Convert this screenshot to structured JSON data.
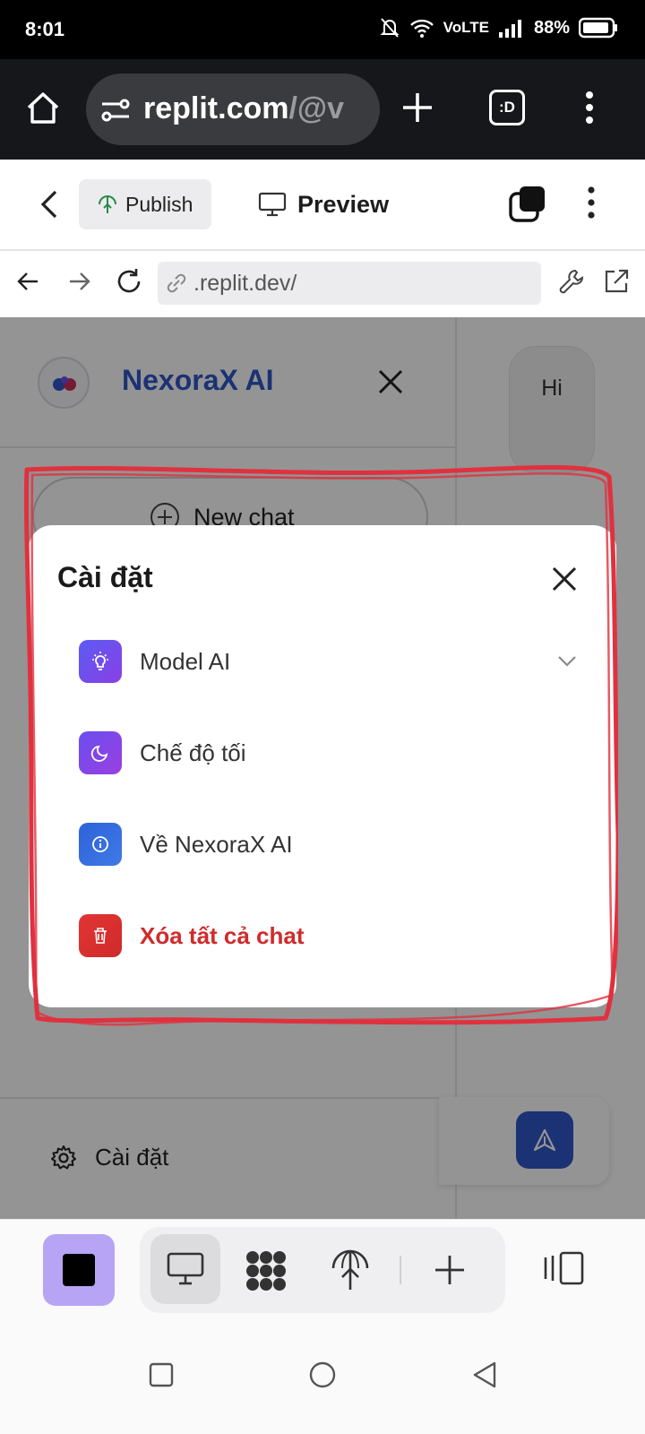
{
  "status_bar": {
    "time": "8:01",
    "network": "VoLTE",
    "battery": "88%"
  },
  "chrome": {
    "url_main": "replit.com",
    "url_tail": "/@v",
    "tab_button_label": ":D"
  },
  "replit": {
    "publish_label": "Publish",
    "preview_label": "Preview"
  },
  "browser": {
    "address": ".replit.dev/"
  },
  "sidebar": {
    "brand": "NexoraX AI",
    "new_chat_label": "New chat",
    "settings_label": "Cài đặt"
  },
  "chat": {
    "message": "Hi"
  },
  "modal": {
    "title": "Cài đặt",
    "items": [
      {
        "label": "Model AI",
        "icon": "lightbulb-icon",
        "color": "#6b4ef0"
      },
      {
        "label": "Chế độ tối",
        "icon": "moon-icon",
        "color": "#7b45e6"
      },
      {
        "label": "Về NexoraX AI",
        "icon": "info-icon",
        "color": "#2e62d8"
      },
      {
        "label": "Xóa tất cả chat",
        "icon": "trash-icon",
        "color": "#e03434"
      }
    ]
  },
  "colors": {
    "accent": "#2f56c9",
    "danger": "#d02b2b",
    "annotation": "#e0313f",
    "toolbar_square": "#b7a4f5"
  }
}
